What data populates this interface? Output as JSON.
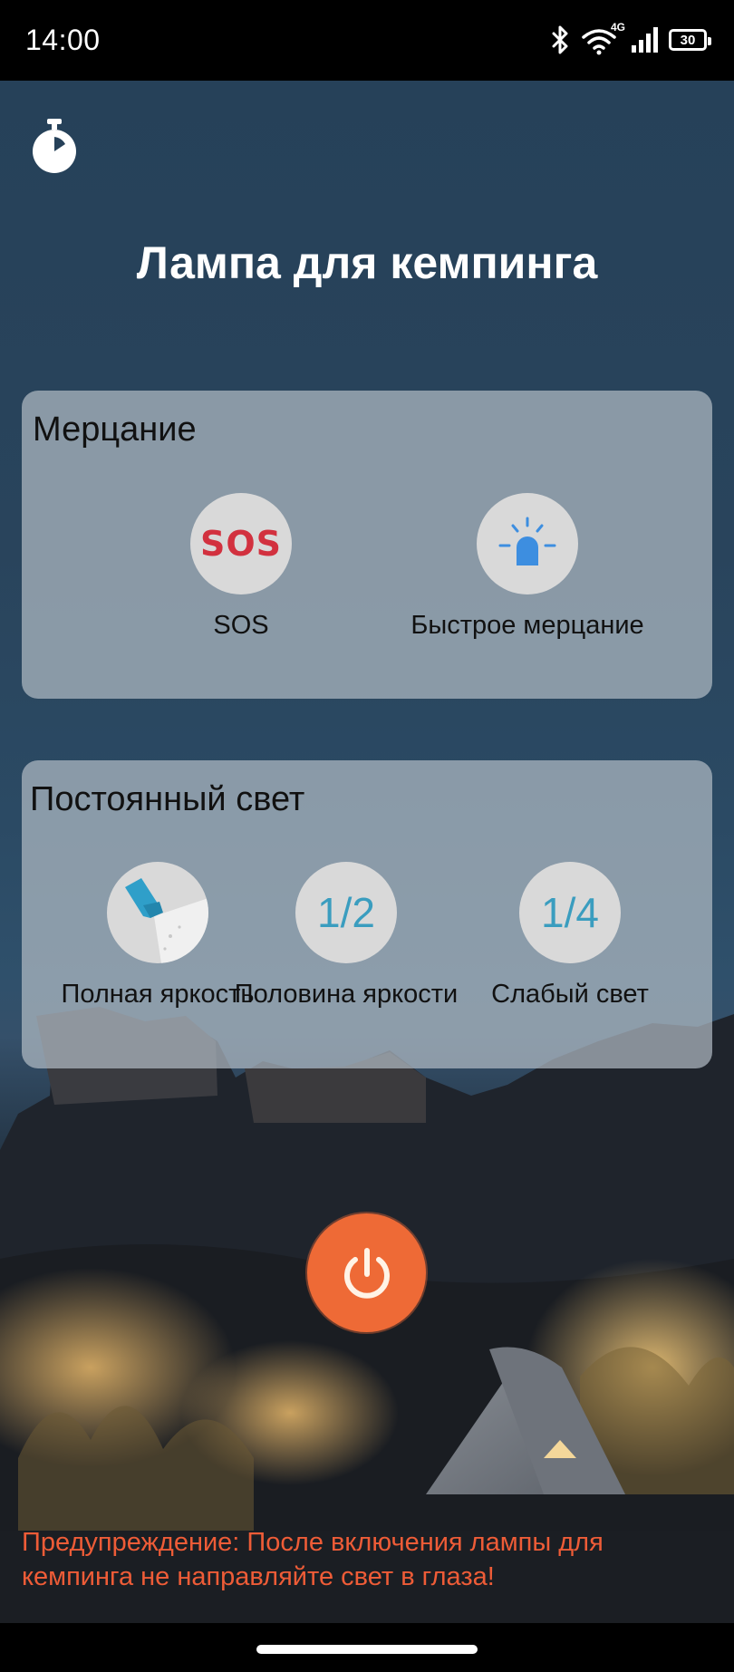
{
  "status_bar": {
    "time": "14:00",
    "network": "4G",
    "battery": "30",
    "icons": [
      "bluetooth-icon",
      "wifi-icon",
      "signal-icon",
      "battery-icon"
    ]
  },
  "header": {
    "timer_icon": "stopwatch-icon",
    "title": "Лампа для кемпинга"
  },
  "flicker": {
    "title": "Мерцание",
    "options": [
      {
        "badge": "SOS",
        "label": "SOS",
        "icon": "sos-icon"
      },
      {
        "label": "Быстрое мерцание",
        "icon": "flashing-bulb-icon"
      }
    ]
  },
  "steady": {
    "title": "Постоянный свет",
    "options": [
      {
        "label": "Полная яркость",
        "icon": "flashlight-icon"
      },
      {
        "badge": "1/2",
        "label": "Половина яркости"
      },
      {
        "badge": "1/4",
        "label": "Слабый свет"
      }
    ]
  },
  "power": {
    "icon": "power-icon"
  },
  "warning": "Предупреждение: После включения лампы для кемпинга не направляйте свет в глаза!",
  "colors": {
    "accent": "#ee6a36",
    "warning": "#ee5c37",
    "sos": "#d2313f",
    "fraction": "#3a9dbf",
    "bulb": "#3d8ee0"
  }
}
